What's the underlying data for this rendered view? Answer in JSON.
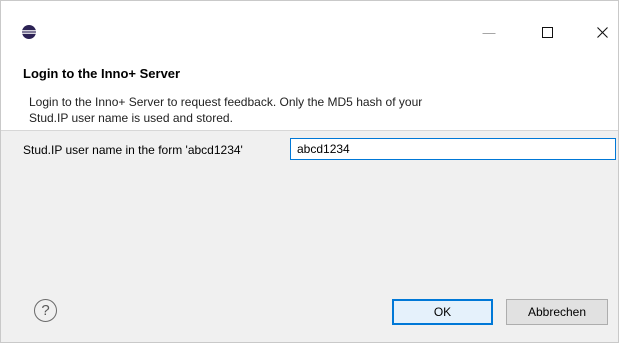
{
  "window": {
    "icon": "eclipse-icon",
    "controls": {
      "minimize": "—",
      "maximize": "☐",
      "close": "✕"
    }
  },
  "dialog": {
    "title": "Login to the Inno+ Server",
    "message_line1": "Login to the Inno+ Server to request feedback. Only the MD5 hash of your",
    "message_line2": "Stud.IP user name is used and stored."
  },
  "form": {
    "username_label": "Stud.IP user name in the form 'abcd1234'",
    "username_value": "abcd1234"
  },
  "buttons": {
    "help": "?",
    "ok": "OK",
    "cancel": "Abbrechen"
  },
  "colors": {
    "accent": "#0078d7",
    "header_bg": "#ffffff",
    "body_bg": "#f0f0f0"
  }
}
